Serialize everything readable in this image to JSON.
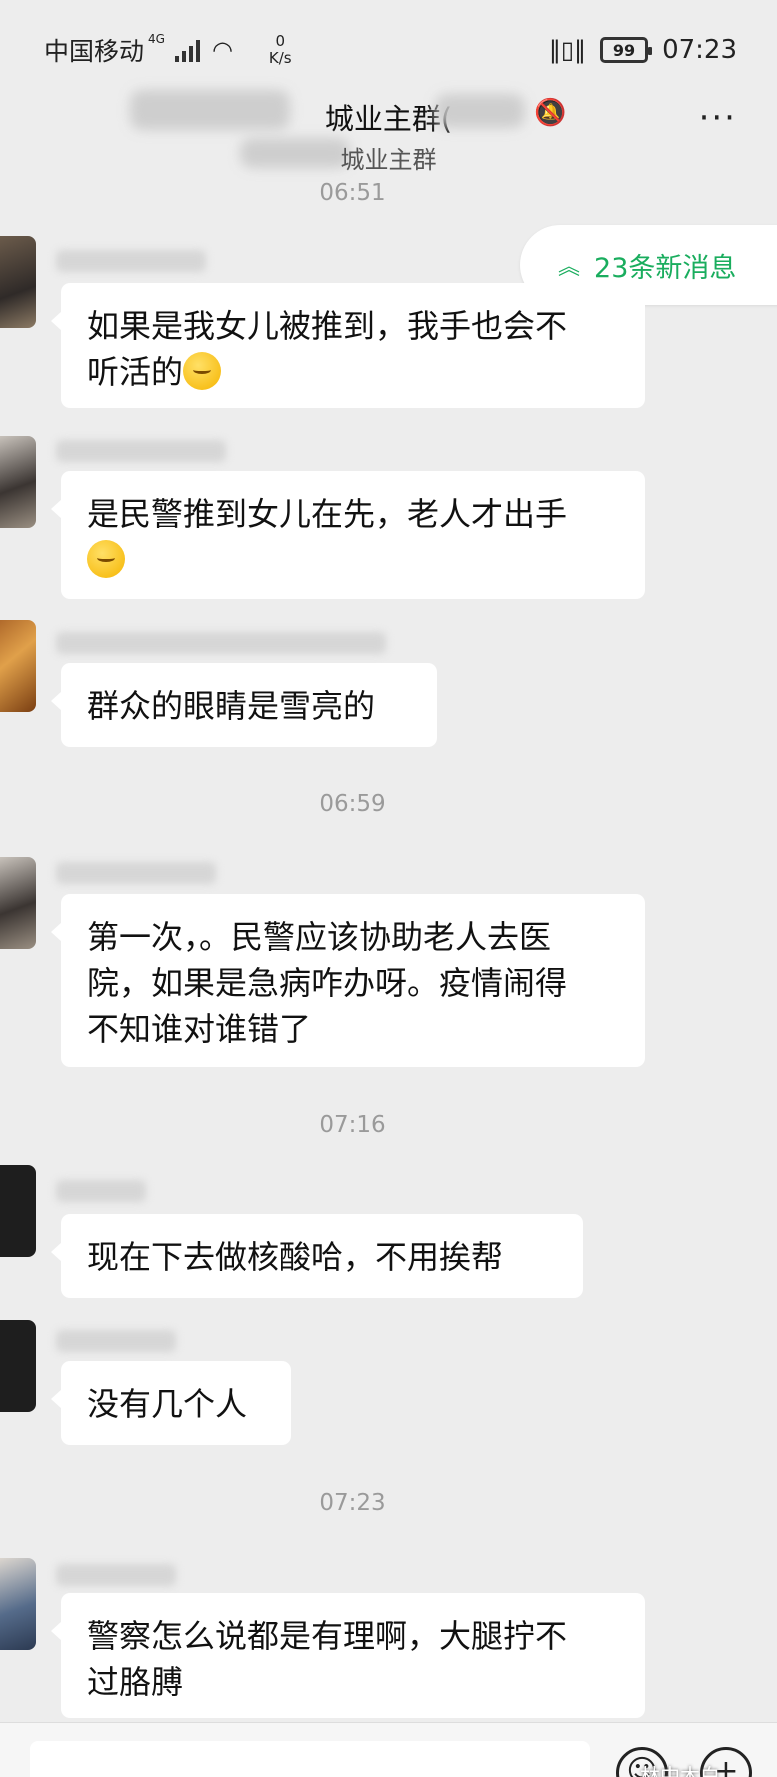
{
  "status_bar": {
    "carrier": "中国移动",
    "network": "4G",
    "speed_value": "0",
    "speed_unit": "K/s",
    "battery": "99",
    "clock": "07:23"
  },
  "header": {
    "title": "城业主群(",
    "subtitle": "城业主群",
    "more": "···"
  },
  "new_messages": {
    "label": "23条新消息"
  },
  "messages": [
    {
      "time": "06:51",
      "text": "如果是我女儿被推到，我手也会不\n听活的",
      "emoji": true
    },
    {
      "text": "是民警推到女儿在先，老人才出手\n",
      "emoji": true
    },
    {
      "text": "群众的眼睛是雪亮的",
      "emoji": false
    },
    {
      "time": "06:59",
      "text": "第一次，。民警应该协助老人去医\n院，如果是急病咋办呀。疫情闹得\n不知谁对谁错了",
      "emoji": false
    },
    {
      "time": "07:16",
      "text": "现在下去做核酸哈，不用挨帮",
      "emoji": false
    },
    {
      "text": "没有几个人",
      "emoji": false
    },
    {
      "time": "07:23",
      "text": "警察怎么说都是有理啊，大腿拧不\n过胳膊",
      "emoji": false
    }
  ],
  "watermark": "林中木白"
}
